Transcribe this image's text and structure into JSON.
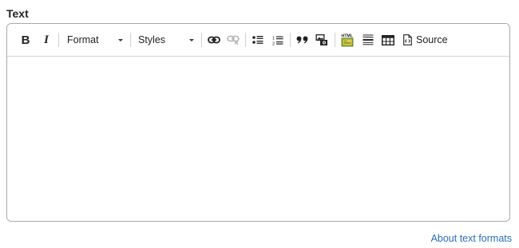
{
  "field": {
    "label": "Text"
  },
  "toolbar": {
    "bold_label": "B",
    "italic_label": "I",
    "format_label": "Format",
    "styles_label": "Styles",
    "source_label": "Source"
  },
  "footer": {
    "about_link": "About text formats"
  },
  "colors": {
    "border": "#a9a9a9",
    "link": "#2a6ebb",
    "image_icon_green": "#8cb33a",
    "image_icon_yellow": "#e9c84b"
  },
  "icons": [
    "link-icon",
    "unlink-icon",
    "bulleted-list-icon",
    "numbered-list-icon",
    "blockquote-icon",
    "image-icon",
    "html-embed-icon",
    "horizontal-line-icon",
    "table-icon",
    "source-icon"
  ]
}
